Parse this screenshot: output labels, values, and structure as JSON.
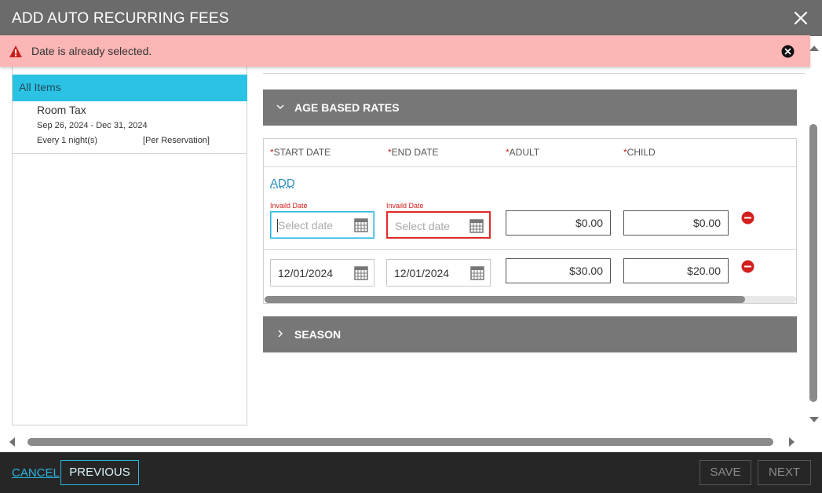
{
  "window": {
    "title": "ADD AUTO RECURRING FEES"
  },
  "alert": {
    "message": "Date is already selected.",
    "icon": "warning-icon",
    "color": "#fcb6b6"
  },
  "sidebar": {
    "all_label": "All Items",
    "items": [
      {
        "name": "Room Tax",
        "dates": "Sep 26, 2024 - Dec 31, 2024",
        "frequency": "Every 1 night(s)",
        "basis": "[Per Reservation]"
      }
    ]
  },
  "age_rates": {
    "title": "AGE BASED RATES",
    "columns": {
      "start": "START DATE",
      "end": "END DATE",
      "adult": "ADULT",
      "child": "CHILD",
      "required_mark": "*"
    },
    "add_label": "ADD",
    "invalid_text": "Invaild Date",
    "rows": [
      {
        "start": "",
        "start_placeholder": "Select date",
        "end": "",
        "end_placeholder": "Select date",
        "adult": "$0.00",
        "child": "$0.00"
      },
      {
        "start": "12/01/2024",
        "end": "12/01/2024",
        "adult": "$30.00",
        "child": "$20.00"
      }
    ]
  },
  "season": {
    "title": "SEASON"
  },
  "footer": {
    "cancel": "CANCEL",
    "previous": "PREVIOUS",
    "save": "SAVE",
    "next": "NEXT"
  },
  "colors": {
    "accent": "#2bc3e3",
    "error": "#d2201e",
    "header": "#6b6b6b",
    "section": "#777777"
  }
}
